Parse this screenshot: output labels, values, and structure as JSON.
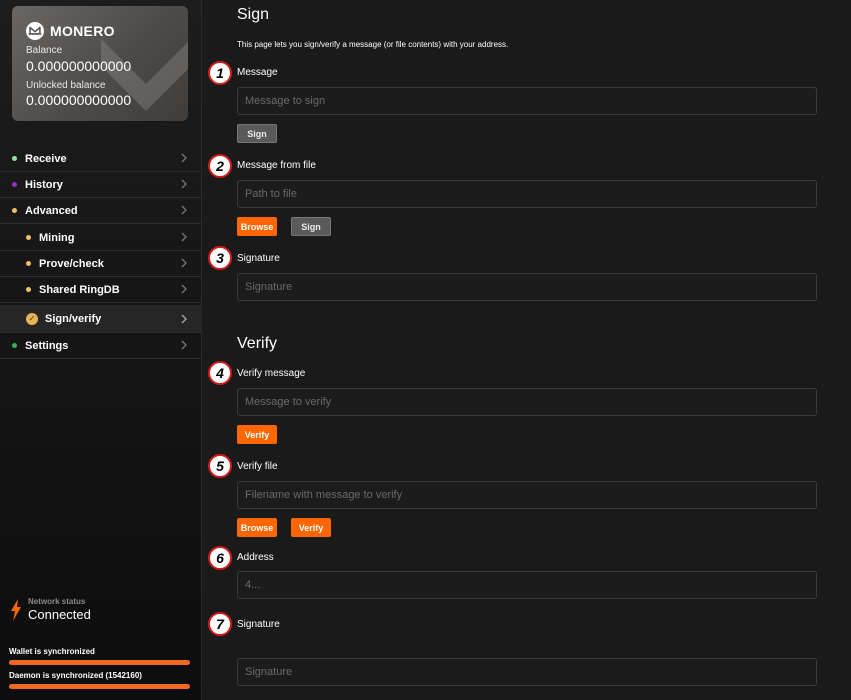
{
  "wallet": {
    "brand": "MONERO",
    "balance_label": "Balance",
    "balance_value": "0.000000000000",
    "unlocked_label": "Unlocked balance",
    "unlocked_value": "0.000000000000"
  },
  "sidebar": {
    "items": [
      {
        "label": "Receive",
        "dot_color": "#9be39b"
      },
      {
        "label": "History",
        "dot_color": "#9b30c9"
      },
      {
        "label": "Advanced",
        "dot_color": "#f3c06a"
      },
      {
        "label": "Mining",
        "dot_color": "#f3c06a"
      },
      {
        "label": "Prove/check",
        "dot_color": "#f3c06a"
      },
      {
        "label": "Shared RingDB",
        "dot_color": "#f3c06a"
      },
      {
        "label": "Sign/verify",
        "dot_color": "#e2b65a"
      },
      {
        "label": "Settings",
        "dot_color": "#36b25b"
      }
    ]
  },
  "status": {
    "network_label": "Network status",
    "network_value": "Connected",
    "wallet_sync": "Wallet is synchronized",
    "daemon_sync": "Daemon is synchronized (1542160)",
    "wallet_progress": 1.0,
    "daemon_progress": 1.0
  },
  "sign": {
    "title": "Sign",
    "description": "This page lets you sign/verify a message (or file contents) with your address.",
    "message_label": "Message",
    "message_placeholder": "Message to sign",
    "sign_button": "Sign",
    "file_label": "Message from file",
    "file_placeholder": "Path to file",
    "browse_button": "Browse",
    "sign_file_button": "Sign",
    "signature_label": "Signature",
    "signature_placeholder": "Signature"
  },
  "verify": {
    "title": "Verify",
    "message_label": "Verify message",
    "message_placeholder": "Message to verify",
    "verify_button": "Verify",
    "file_label": "Verify file",
    "file_placeholder": "Filename with message to verify",
    "browse_button": "Browse",
    "verify_file_button": "Verify",
    "address_label": "Address",
    "address_placeholder": "4...",
    "signature_label": "Signature",
    "signature_placeholder": "Signature"
  },
  "annotations": [
    "1",
    "2",
    "3",
    "4",
    "5",
    "6",
    "7"
  ],
  "colors": {
    "accent": "#ff6600",
    "marker_border": "#d11b1b"
  }
}
